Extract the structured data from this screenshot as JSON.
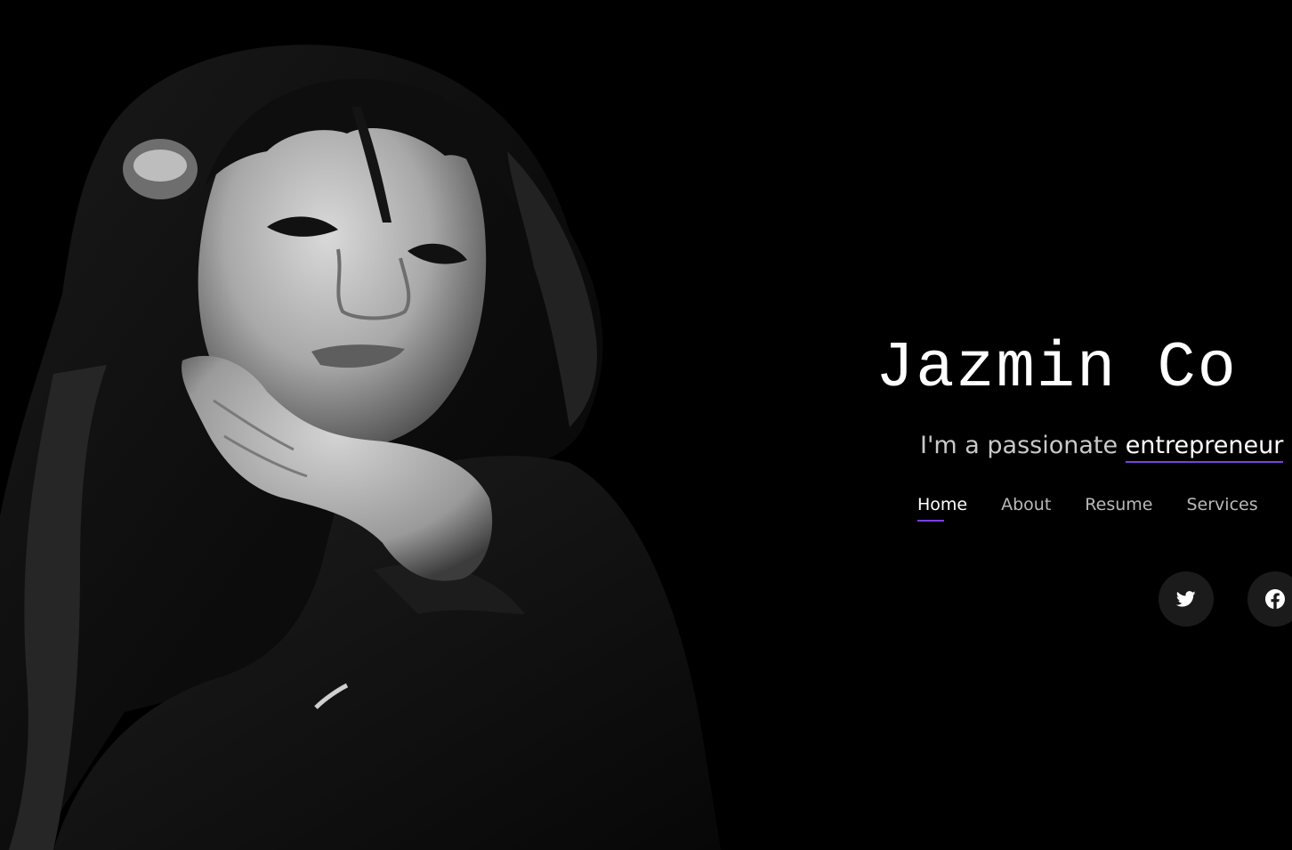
{
  "hero": {
    "name": "Jazmin Co",
    "tagline_prefix": "I'm a passionate ",
    "tagline_typed": "entrepreneur",
    "accent_color": "#7b3fe4"
  },
  "nav": {
    "items": [
      {
        "label": "Home",
        "active": true
      },
      {
        "label": "About",
        "active": false
      },
      {
        "label": "Resume",
        "active": false
      },
      {
        "label": "Services",
        "active": false
      }
    ]
  },
  "social": {
    "icons": [
      "twitter-icon",
      "facebook-icon"
    ]
  },
  "portrait": {
    "description": "grayscale-photo"
  }
}
